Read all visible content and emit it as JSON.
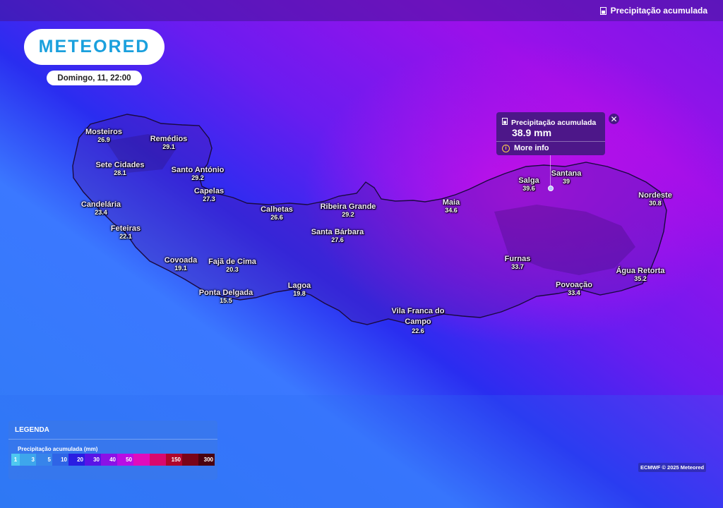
{
  "header": {
    "layer_name": "Precipitação acumulada",
    "layer_icon": "rain-gauge-icon"
  },
  "brand": {
    "logo": "METEORED",
    "logo_color": "#1aa0dd"
  },
  "date": "Domingo, 11, 22:00",
  "towns": [
    {
      "name": "Mosteiros",
      "value": "26.9"
    },
    {
      "name": "Remédios",
      "value": "29.1"
    },
    {
      "name": "Sete Cidades",
      "value": "28.1"
    },
    {
      "name": "Santo António",
      "value": "29.2"
    },
    {
      "name": "Capelas",
      "value": "27.3"
    },
    {
      "name": "Candelária",
      "value": "23.4"
    },
    {
      "name": "Feteiras",
      "value": "22.1"
    },
    {
      "name": "Calhetas",
      "value": "26.6"
    },
    {
      "name": "Ribeira Grande",
      "value": "29.2"
    },
    {
      "name": "Santa Bárbara",
      "value": "27.6"
    },
    {
      "name": "Maia",
      "value": "34.6"
    },
    {
      "name": "Salga",
      "value": "39.6"
    },
    {
      "name": "Santana",
      "value": "39"
    },
    {
      "name": "Nordeste",
      "value": "30.8"
    },
    {
      "name": "Covoada",
      "value": "19.1"
    },
    {
      "name": "Fajã de Cima",
      "value": "20.3"
    },
    {
      "name": "Ponta Delgada",
      "value": "15.5"
    },
    {
      "name": "Lagoa",
      "value": "19.8"
    },
    {
      "name": "Vila Franca do Campo",
      "value": "22.6"
    },
    {
      "name": "Furnas",
      "value": "33.7"
    },
    {
      "name": "Povoação",
      "value": "33.4"
    },
    {
      "name": "Água Retorta",
      "value": "35.2"
    }
  ],
  "popup": {
    "title": "Precipitação acumulada",
    "value": "38.9 mm",
    "more_info": "More info",
    "close": "✕"
  },
  "legend": {
    "title": "LEGENDA",
    "subtitle": "Precipitação acumulada (mm)",
    "stops": [
      {
        "label": "1",
        "color": "#4ec8f0"
      },
      {
        "label": "3",
        "color": "#3ea6ec"
      },
      {
        "label": "5",
        "color": "#3784ea"
      },
      {
        "label": "10",
        "color": "#2f64e6"
      },
      {
        "label": "20",
        "color": "#2a1ee2"
      },
      {
        "label": "30",
        "color": "#5a14e6"
      },
      {
        "label": "40",
        "color": "#8a12e6"
      },
      {
        "label": "50",
        "color": "#b80ee4"
      },
      {
        "label": "",
        "color": "#e00cbc"
      },
      {
        "label": "",
        "color": "#d8086e"
      },
      {
        "label": "150",
        "color": "#b0062c"
      },
      {
        "label": "",
        "color": "#7a0418"
      },
      {
        "label": "300",
        "color": "#4a0210"
      }
    ]
  },
  "credit": "ECMWF © 2025 Meteored"
}
